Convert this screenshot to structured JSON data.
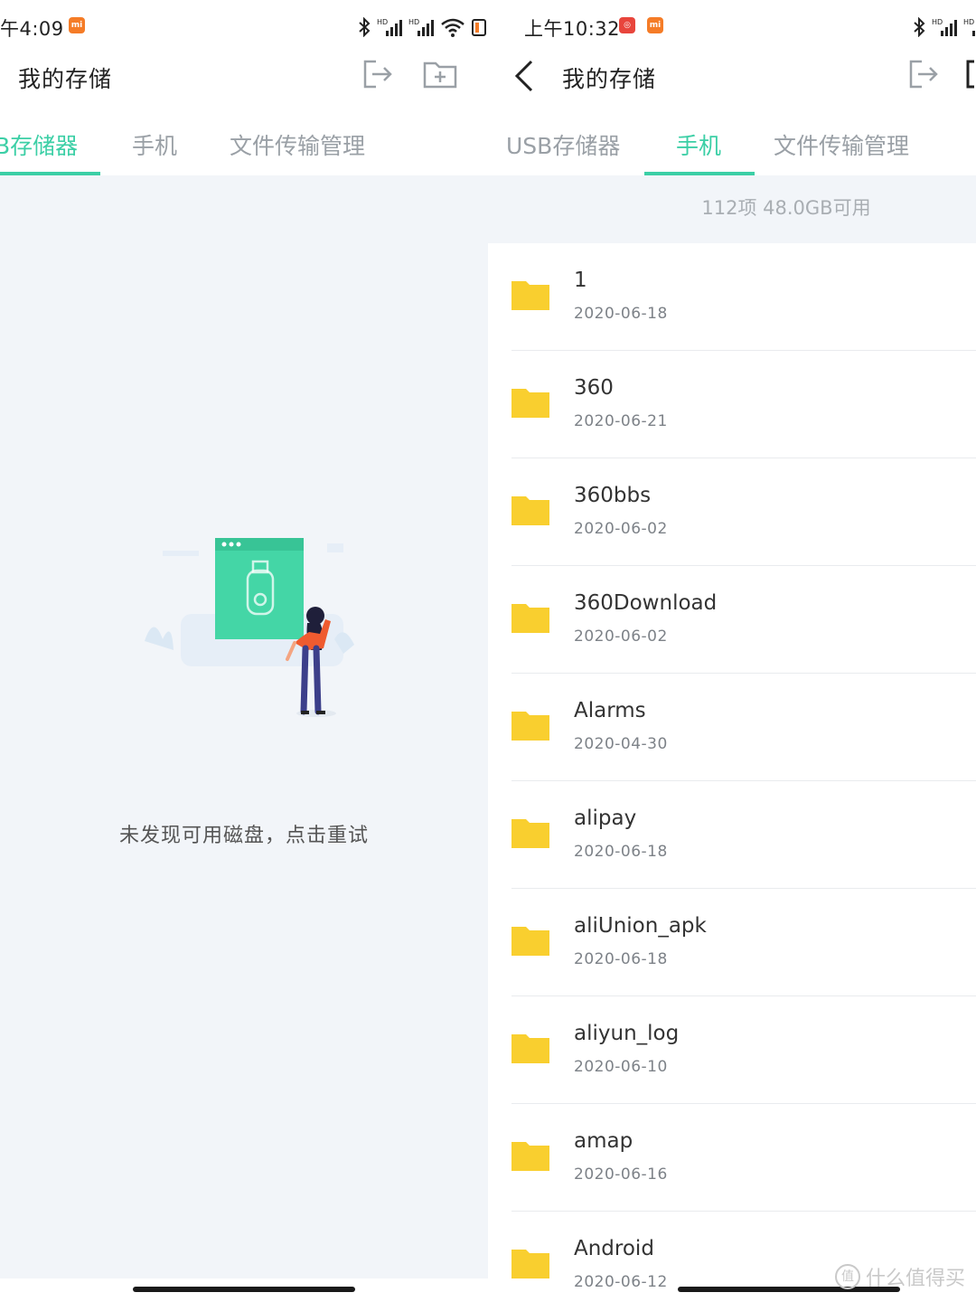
{
  "left_screen": {
    "status": {
      "time": "午4:09",
      "badge_color": "#f57c27"
    },
    "header": {
      "title": "我的存储"
    },
    "tabs": [
      {
        "label": "B存储器",
        "active": true
      },
      {
        "label": "手机",
        "active": false
      },
      {
        "label": "文件传输管理",
        "active": false
      }
    ],
    "empty_state": {
      "message": "未发现可用磁盘，点击重试"
    }
  },
  "right_screen": {
    "status": {
      "time": "上午10:32",
      "badge1_color": "#e8453c",
      "badge2_color": "#f57c27"
    },
    "header": {
      "title": "我的存储"
    },
    "tabs": [
      {
        "label": "USB存储器",
        "active": false
      },
      {
        "label": "手机",
        "active": true
      },
      {
        "label": "文件传输管理",
        "active": false
      }
    ],
    "summary": "112项 48.0GB可用",
    "files": [
      {
        "name": "1",
        "date": "2020-06-18"
      },
      {
        "name": "360",
        "date": "2020-06-21"
      },
      {
        "name": "360bbs",
        "date": "2020-06-02"
      },
      {
        "name": "360Download",
        "date": "2020-06-02"
      },
      {
        "name": "Alarms",
        "date": "2020-04-30"
      },
      {
        "name": "alipay",
        "date": "2020-06-18"
      },
      {
        "name": "aliUnion_apk",
        "date": "2020-06-18"
      },
      {
        "name": "aliyun_log",
        "date": "2020-06-10"
      },
      {
        "name": "amap",
        "date": "2020-06-16"
      },
      {
        "name": "Android",
        "date": "2020-06-12"
      }
    ]
  },
  "watermark": "什么值得买",
  "accent_color": "#3ccfa6",
  "folder_color": "#f9cf2f"
}
